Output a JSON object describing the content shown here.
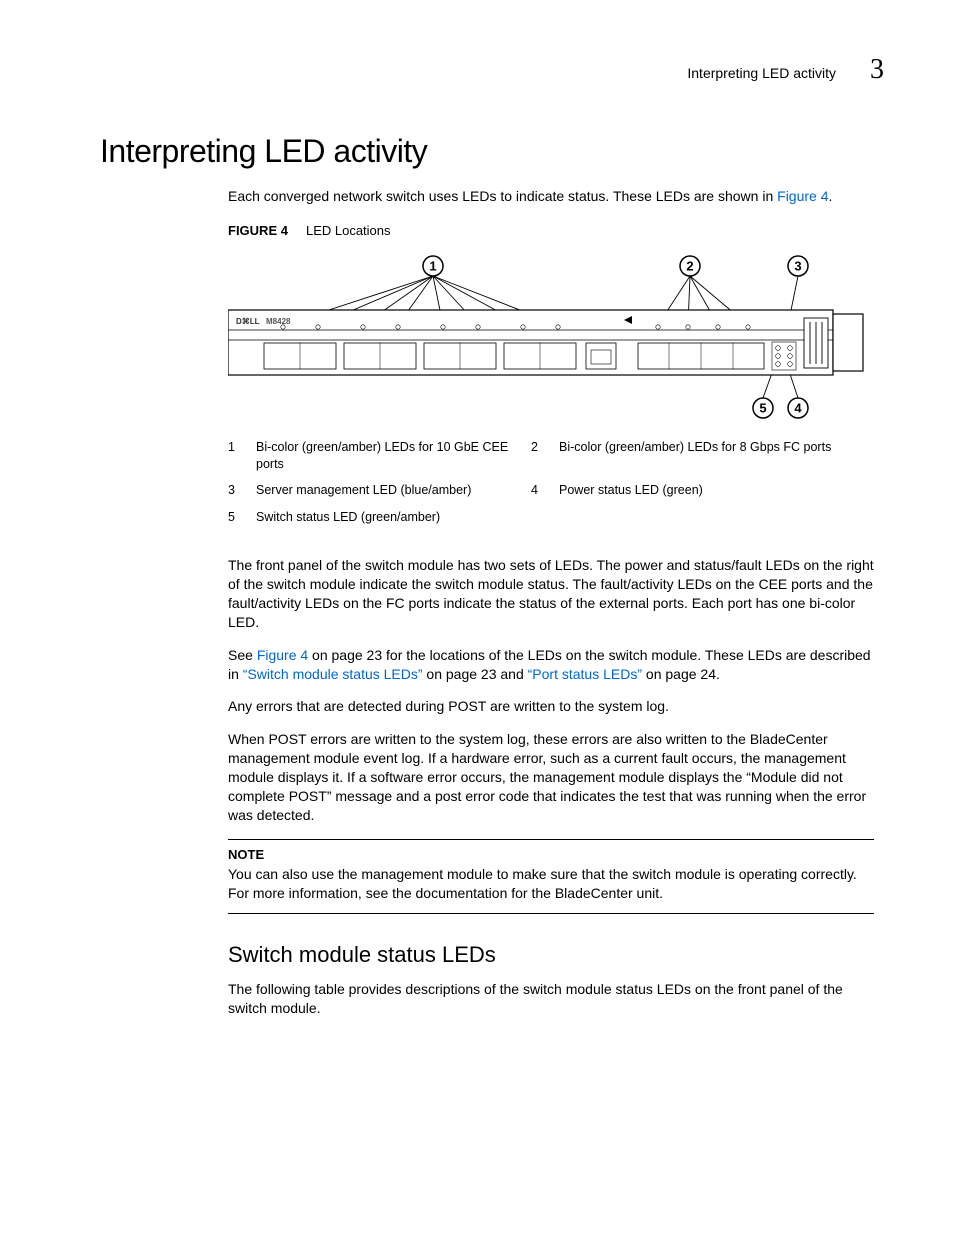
{
  "header": {
    "running_title": "Interpreting LED activity",
    "chapter_number": "3"
  },
  "title": "Interpreting LED activity",
  "intro": {
    "text_before_link": "Each converged network switch uses LEDs to indicate status. These LEDs are shown in ",
    "link_text": "Figure 4",
    "text_after_link": "."
  },
  "figure": {
    "label": "FIGURE 4",
    "caption": "LED Locations",
    "device_label": "M8428",
    "callouts": [
      "1",
      "2",
      "3",
      "4",
      "5"
    ]
  },
  "legend": {
    "r1c1n": "1",
    "r1c1t": "Bi-color (green/amber) LEDs for 10 GbE CEE ports",
    "r1c2n": "2",
    "r1c2t": "Bi-color (green/amber) LEDs for 8 Gbps FC ports",
    "r2c1n": "3",
    "r2c1t": "Server management LED (blue/amber)",
    "r2c2n": "4",
    "r2c2t": "Power status LED (green)",
    "r3c1n": "5",
    "r3c1t": "Switch status LED (green/amber)"
  },
  "para1": "The front panel of the switch module has two sets of LEDs. The power and status/fault LEDs on the right of the switch module indicate the switch module status. The fault/activity LEDs on the CEE ports and the fault/activity LEDs on the FC ports indicate the status of the external ports. Each port has one bi-color LED.",
  "para2": {
    "p1": "See ",
    "l1": "Figure 4",
    "p2": " on page 23 for the locations of the LEDs on the switch module. These LEDs are described in ",
    "l2": "“Switch module status LEDs”",
    "p3": " on page 23 and ",
    "l3": "“Port status LEDs”",
    "p4": " on page 24."
  },
  "para3": "Any errors that are detected during POST are written to the system log.",
  "para4": "When POST errors are written to the system log, these errors are also written to the BladeCenter management module event log. If a hardware error, such as a current fault occurs, the management module displays it. If a software error occurs, the management module displays the “Module did not complete POST” message and a post error code that indicates the test that was running when the error was detected.",
  "note": {
    "head": "NOTE",
    "text": "You can also use the management module to make sure that the switch module is operating correctly. For more information, see the documentation for the BladeCenter unit."
  },
  "subhead": "Switch module status LEDs",
  "para5": "The following table provides descriptions of the switch module status LEDs on the front panel of the switch module."
}
